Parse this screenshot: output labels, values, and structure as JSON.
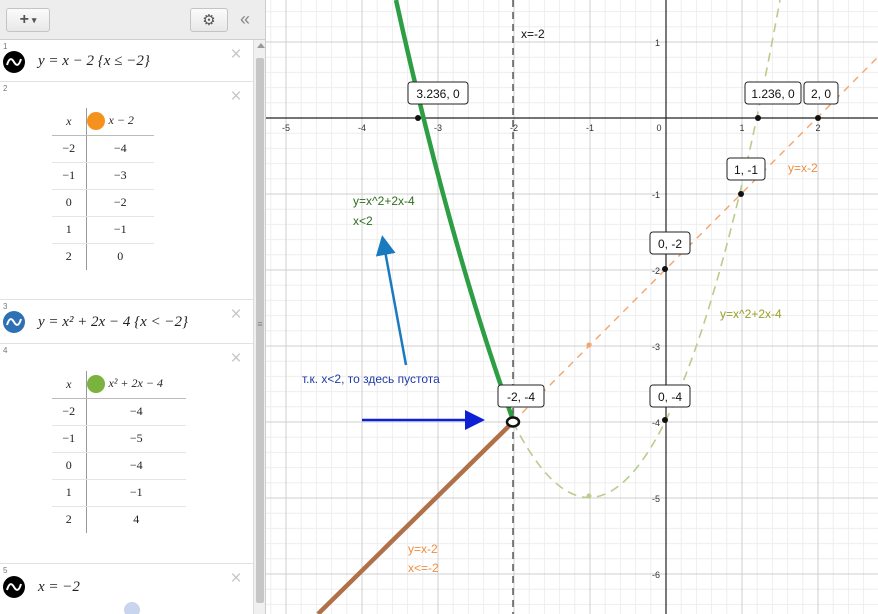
{
  "toolbar": {
    "add_icon": "+",
    "add_caret": "▾",
    "settings_icon": "⚙",
    "collapse_icon": "«"
  },
  "expressions": [
    {
      "index": "1",
      "formula": "y = x − 2 {x ≤ −2}",
      "color": "#000000"
    },
    {
      "index": "2",
      "table_header": {
        "x": "x",
        "y": "x − 2"
      },
      "color": "#f5921e",
      "rows": [
        [
          "−2",
          "−4"
        ],
        [
          "−1",
          "−3"
        ],
        [
          "0",
          "−2"
        ],
        [
          "1",
          "−1"
        ],
        [
          "2",
          "0"
        ]
      ]
    },
    {
      "index": "3",
      "formula": "y = x² + 2x − 4 {x < −2}",
      "color": "#2d70b3"
    },
    {
      "index": "4",
      "table_header": {
        "x": "x",
        "y": "x² + 2x − 4"
      },
      "color": "#7ab33e",
      "rows": [
        [
          "−2",
          "−4"
        ],
        [
          "−1",
          "−5"
        ],
        [
          "0",
          "−4"
        ],
        [
          "1",
          "−1"
        ],
        [
          "2",
          "4"
        ]
      ]
    },
    {
      "index": "5",
      "formula": "x = −2",
      "color": "#000000"
    }
  ],
  "graph": {
    "x_ticks": [
      "-5",
      "-4",
      "-3",
      "-2",
      "-1",
      "0",
      "1",
      "2"
    ],
    "y_ticks": [
      "1",
      "-1",
      "-2",
      "-3",
      "-4",
      "-5",
      "-6"
    ],
    "point_labels": {
      "p1": "3.236, 0",
      "p2": "1.236, 0",
      "p3": "2, 0",
      "p4": "1, -1",
      "p5": "0, -2",
      "p6": "-2, -4",
      "p7": "0, -4"
    },
    "annotations": {
      "vline": "x=-2",
      "line_label": "y=x-2",
      "parabola_label": "y=x^2+2x-4",
      "green_label_1": "y=x^2+2x-4",
      "green_label_2": "x<2",
      "note": "т.к. x<2, то здесь пустота",
      "brown_label_1": "y=x-2",
      "brown_label_2": "x<=-2"
    },
    "colors": {
      "green": "#2e9e45",
      "orange": "#f5a36b",
      "olive_dash": "#b9cc8c",
      "brown": "#b07048",
      "blue_arrow": "#1a7abf",
      "dark_blue_arrow": "#0f1fd6",
      "label_orange": "#f08c3c",
      "label_olive": "#9aa026",
      "label_green": "#2e6e1e"
    }
  }
}
